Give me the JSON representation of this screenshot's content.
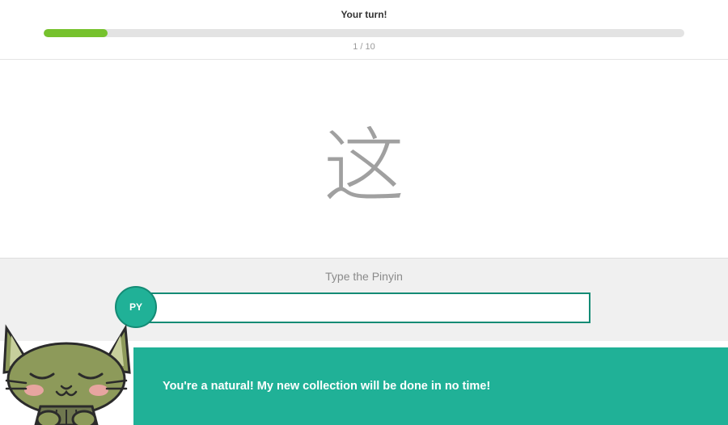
{
  "header": {
    "turn_label": "Your turn!",
    "progress_text": "1 / 10",
    "progress_percent": 10
  },
  "card": {
    "hanzi": "这"
  },
  "answer": {
    "prompt": "Type the Pinyin",
    "badge_label": "PY",
    "input_value": ""
  },
  "feedback": {
    "message": "You're a natural! My new collection will be done in no time!"
  },
  "colors": {
    "accent_green": "#20b197",
    "progress_green": "#76c22d"
  }
}
